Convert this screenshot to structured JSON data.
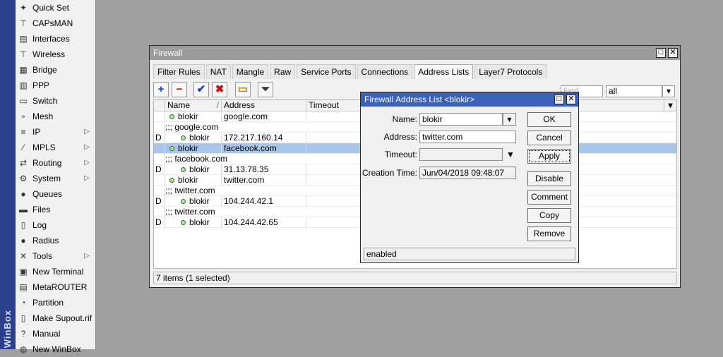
{
  "sidebar": {
    "vertical_label": "WinBox",
    "items": [
      {
        "label": "Quick Set",
        "icon": "wand-icon",
        "glyph": "✦",
        "submenu": false
      },
      {
        "label": "CAPsMAN",
        "icon": "antenna-icon",
        "glyph": "⊤",
        "submenu": false
      },
      {
        "label": "Interfaces",
        "icon": "interfaces-icon",
        "glyph": "▤",
        "submenu": false
      },
      {
        "label": "Wireless",
        "icon": "wireless-icon",
        "glyph": "⊤",
        "submenu": false
      },
      {
        "label": "Bridge",
        "icon": "bridge-icon",
        "glyph": "▦",
        "submenu": false
      },
      {
        "label": "PPP",
        "icon": "ppp-icon",
        "glyph": "▥",
        "submenu": false
      },
      {
        "label": "Switch",
        "icon": "switch-icon",
        "glyph": "▭",
        "submenu": false
      },
      {
        "label": "Mesh",
        "icon": "mesh-icon",
        "glyph": "∘",
        "submenu": false
      },
      {
        "label": "IP",
        "icon": "ip-icon",
        "glyph": "≡",
        "submenu": true
      },
      {
        "label": "MPLS",
        "icon": "mpls-icon",
        "glyph": "⁄",
        "submenu": true
      },
      {
        "label": "Routing",
        "icon": "routing-icon",
        "glyph": "⇄",
        "submenu": true
      },
      {
        "label": "System",
        "icon": "gear-icon",
        "glyph": "⚙",
        "submenu": true
      },
      {
        "label": "Queues",
        "icon": "queues-icon",
        "glyph": "●",
        "submenu": false
      },
      {
        "label": "Files",
        "icon": "folder-icon",
        "glyph": "▬",
        "submenu": false
      },
      {
        "label": "Log",
        "icon": "log-icon",
        "glyph": "▯",
        "submenu": false
      },
      {
        "label": "Radius",
        "icon": "radius-icon",
        "glyph": "●",
        "submenu": false
      },
      {
        "label": "Tools",
        "icon": "tools-icon",
        "glyph": "✕",
        "submenu": true
      },
      {
        "label": "New Terminal",
        "icon": "terminal-icon",
        "glyph": "▣",
        "submenu": false
      },
      {
        "label": "MetaROUTER",
        "icon": "metarouter-icon",
        "glyph": "▤",
        "submenu": false
      },
      {
        "label": "Partition",
        "icon": "partition-icon",
        "glyph": "◔",
        "submenu": false
      },
      {
        "label": "Make Supout.rif",
        "icon": "document-icon",
        "glyph": "▯",
        "submenu": false
      },
      {
        "label": "Manual",
        "icon": "help-icon",
        "glyph": "?",
        "submenu": false
      },
      {
        "label": "New WinBox",
        "icon": "globe-icon",
        "glyph": "◍",
        "submenu": false
      }
    ]
  },
  "firewall": {
    "title": "Firewall",
    "tabs": [
      "Filter Rules",
      "NAT",
      "Mangle",
      "Raw",
      "Service Ports",
      "Connections",
      "Address Lists",
      "Layer7 Protocols"
    ],
    "active_tab": "Address Lists",
    "find_placeholder": "Find",
    "filter_value": "all",
    "columns": [
      "Name",
      "Address",
      "Timeout"
    ],
    "sort_indicator": "/",
    "rows": [
      {
        "flag": "",
        "comment": "",
        "name": "blokir",
        "address": "google.com",
        "selected": false
      },
      {
        "flag": "",
        "comment": ";;; google.com",
        "name": "",
        "address": "",
        "selected": false
      },
      {
        "flag": "D",
        "comment": "",
        "name": "blokir",
        "address": "172.217.160.14",
        "selected": false,
        "indent": true
      },
      {
        "flag": "",
        "comment": "",
        "name": "blokir",
        "address": "facebook.com",
        "selected": true
      },
      {
        "flag": "",
        "comment": ";;; facebook.com",
        "name": "",
        "address": "",
        "selected": false
      },
      {
        "flag": "D",
        "comment": "",
        "name": "blokir",
        "address": "31.13.78.35",
        "selected": false,
        "indent": true
      },
      {
        "flag": "",
        "comment": "",
        "name": "blokir",
        "address": "twitter.com",
        "selected": false
      },
      {
        "flag": "",
        "comment": ";;; twitter.com",
        "name": "",
        "address": "",
        "selected": false
      },
      {
        "flag": "D",
        "comment": "",
        "name": "blokir",
        "address": "104.244.42.1",
        "selected": false,
        "indent": true
      },
      {
        "flag": "",
        "comment": ";;; twitter.com",
        "name": "",
        "address": "",
        "selected": false
      },
      {
        "flag": "D",
        "comment": "",
        "name": "blokir",
        "address": "104.244.42.65",
        "selected": false,
        "indent": true
      }
    ],
    "status": "7 items (1 selected)"
  },
  "dialog": {
    "title": "Firewall Address List <blokir>",
    "name_label": "Name:",
    "name_value": "blokir",
    "address_label": "Address:",
    "address_value": "twitter.com",
    "timeout_label": "Timeout:",
    "timeout_value": "",
    "creation_label": "Creation Time:",
    "creation_value": "Jun/04/2018 09:48:07",
    "buttons": {
      "ok": "OK",
      "cancel": "Cancel",
      "apply": "Apply",
      "disable": "Disable",
      "comment": "Comment",
      "copy": "Copy",
      "remove": "Remove"
    },
    "status": "enabled"
  },
  "colors": {
    "dialog_title": "#3c62b8",
    "firewall_title": "#9b9b9b",
    "selected_row": "#a9c6e8",
    "sidebar_strip": "#2b3f8c"
  }
}
